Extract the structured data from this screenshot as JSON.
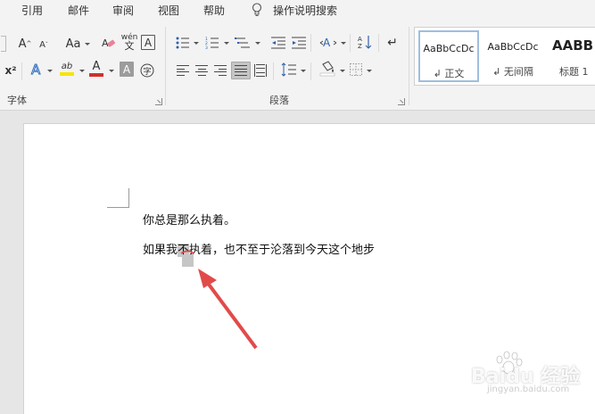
{
  "tabs": [
    "引用",
    "邮件",
    "审阅",
    "视图",
    "帮助"
  ],
  "tell_me": "操作说明搜索",
  "ribbon": {
    "font_group_label": "字体",
    "paragraph_group_label": "段落",
    "change_case_label": "Aa",
    "phonetic_guide_label": "wén",
    "superscript_label": "x²"
  },
  "styles": [
    {
      "sample": "AaBbCcDc",
      "name": "↲ 正文"
    },
    {
      "sample": "AaBbCcDc",
      "name": "↲ 无间隔"
    },
    {
      "sample": "AABB",
      "name": "标题 1"
    }
  ],
  "document": {
    "line1": "你总是那么执着。",
    "line2_before": "如果我",
    "line2_highlight": "不",
    "line2_after": "执着，也不至于沦落到今天这个地步"
  },
  "watermark": {
    "brand": "Baidu 经验",
    "url": "jingyan.baidu.com"
  },
  "colors": {
    "accent_arrow": "#e24a4a",
    "highlight_yellow": "#f5e500",
    "font_red": "#d2302b",
    "selected_button": "#c5c5c5"
  }
}
